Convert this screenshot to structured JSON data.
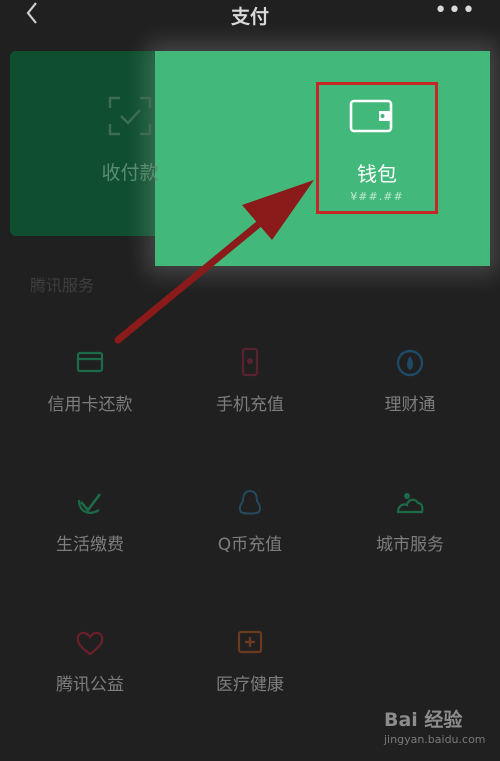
{
  "header": {
    "title": "支付",
    "back_icon": "chevron-left-icon",
    "more_label": "•••"
  },
  "card": {
    "pay_label": "收付款",
    "pay_icon": "scan-frame-icon",
    "wallet_label": "钱包",
    "wallet_icon": "wallet-icon",
    "wallet_sub": "¥##.##"
  },
  "section": {
    "title": "腾讯服务"
  },
  "services": [
    {
      "label": "信用卡还款",
      "icon": "credit-card-icon"
    },
    {
      "label": "手机充值",
      "icon": "phone-icon"
    },
    {
      "label": "理财通",
      "icon": "drop-icon"
    },
    {
      "label": "生活缴费",
      "icon": "check-leaf-icon"
    },
    {
      "label": "Q币充值",
      "icon": "penguin-icon"
    },
    {
      "label": "城市服务",
      "icon": "city-icon"
    },
    {
      "label": "腾讯公益",
      "icon": "heart-icon"
    },
    {
      "label": "医疗健康",
      "icon": "medical-cross-icon"
    }
  ],
  "watermark": {
    "logo": "Bai 经验",
    "url": "jingyan.baidu.com"
  },
  "colors": {
    "background": "#202020",
    "card": "#0f4f2f",
    "spotlight": "#42b97a",
    "highlight_border": "#c62828",
    "arrow": "#8b1a1a"
  }
}
